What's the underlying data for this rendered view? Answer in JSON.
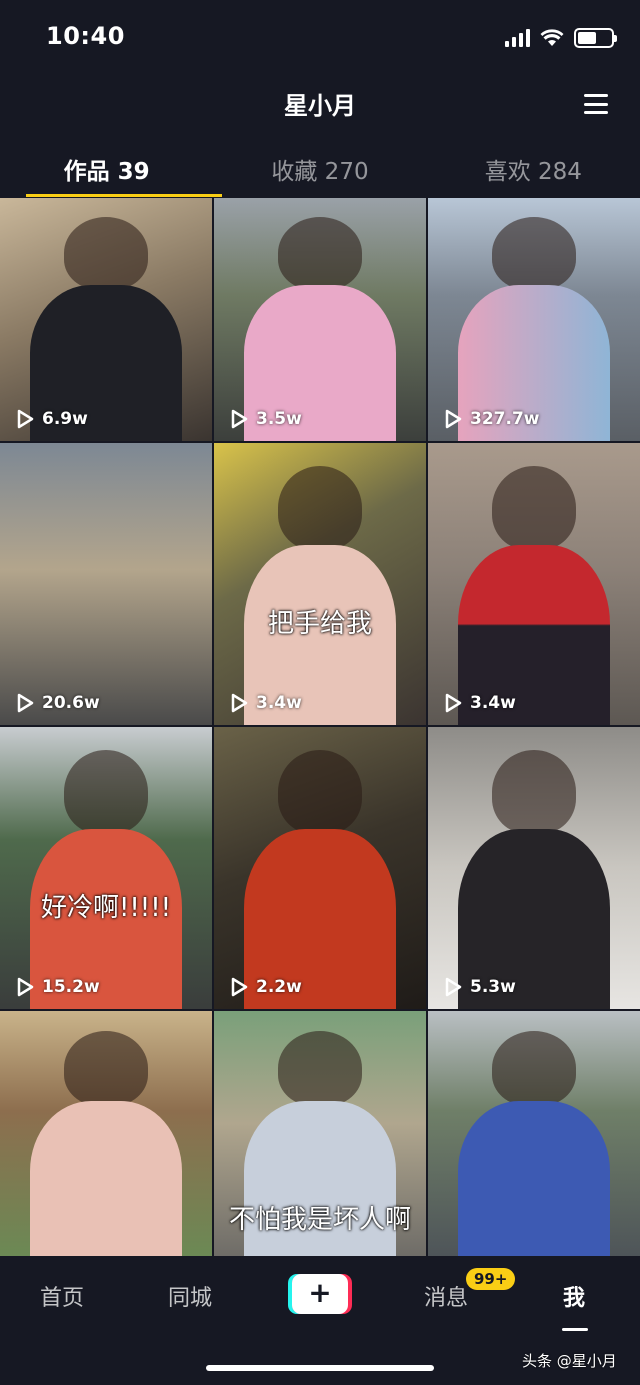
{
  "status_bar": {
    "time": "10:40"
  },
  "header": {
    "title": "星小月"
  },
  "tabs": [
    {
      "label": "作品 39",
      "active": true
    },
    {
      "label": "收藏 270",
      "active": false
    },
    {
      "label": "喜欢 284",
      "active": false
    }
  ],
  "videos": [
    {
      "views": "6.9w",
      "caption": ""
    },
    {
      "views": "3.5w",
      "caption": ""
    },
    {
      "views": "327.7w",
      "caption": ""
    },
    {
      "views": "20.6w",
      "caption": ""
    },
    {
      "views": "3.4w",
      "caption": "把手给我"
    },
    {
      "views": "3.4w",
      "caption": ""
    },
    {
      "views": "15.2w",
      "caption": "好冷啊!!!!!"
    },
    {
      "views": "2.2w",
      "caption": ""
    },
    {
      "views": "5.3w",
      "caption": ""
    },
    {
      "views": "",
      "caption": ""
    },
    {
      "views": "",
      "caption": "不怕我是坏人啊"
    },
    {
      "views": "",
      "caption": ""
    }
  ],
  "bottom_nav": {
    "home": "首页",
    "nearby": "同城",
    "create": "+",
    "messages": "消息",
    "messages_badge": "99+",
    "me": "我"
  },
  "watermark": "头条 @星小月",
  "colors": {
    "background": "#161823",
    "accent_yellow": "#face15",
    "brand_cyan": "#25f4ee",
    "brand_red": "#fe2c55"
  }
}
